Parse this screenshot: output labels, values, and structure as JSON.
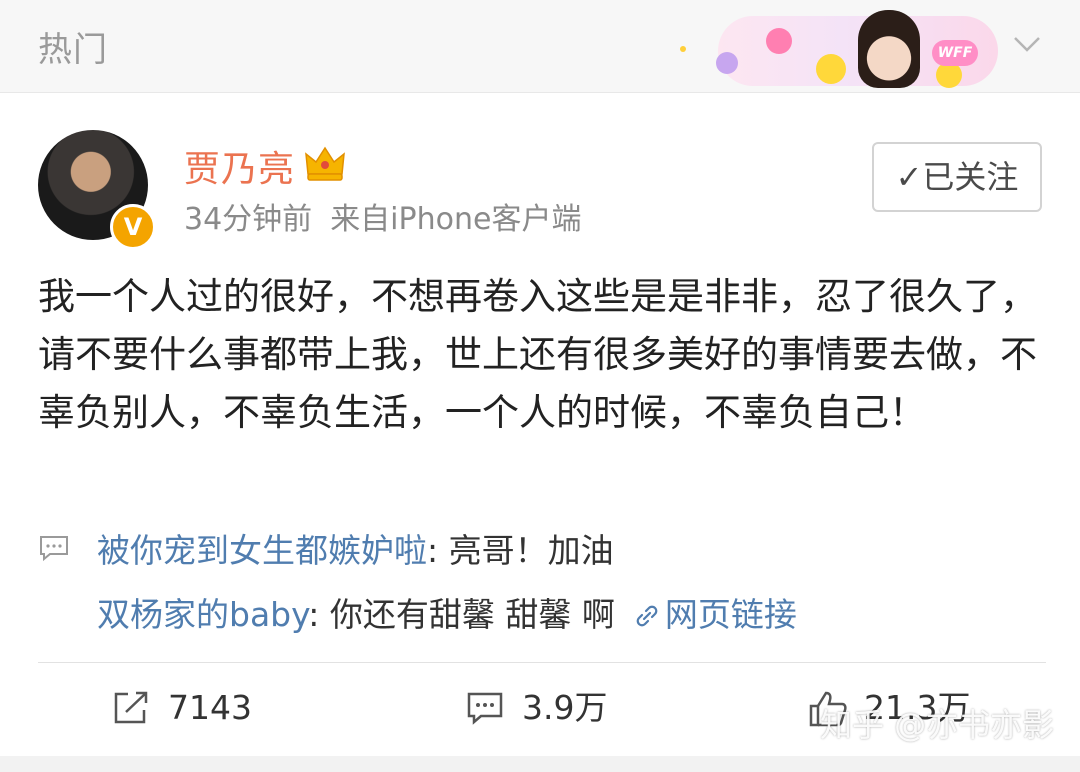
{
  "header": {
    "title": "热门",
    "banner_badge": "WFF",
    "expand_icon": "chevron-down-icon"
  },
  "post": {
    "username": "贾乃亮",
    "verified_icon": "crown-icon",
    "verified_badge": "V",
    "time": "34分钟前",
    "source": "来自iPhone客户端",
    "follow_label": "✓已关注",
    "text": "我一个人过的很好，不想再卷入这些是是非非，忍了很久了，请不要什么事都带上我，世上还有很多美好的事情要去做，不辜负别人，不辜负生活，一个人的时候，不辜负自己！"
  },
  "comments": [
    {
      "nick": "被你宠到女生都嫉妒啦",
      "text": ": 亮哥！加油",
      "link": ""
    },
    {
      "nick": "双杨家的baby",
      "text": ": 你还有甜馨 甜馨 啊",
      "link": "网页链接"
    }
  ],
  "actions": {
    "repost": {
      "icon": "share-icon",
      "count": "7143"
    },
    "comment": {
      "icon": "comment-icon",
      "count": "3.9万"
    },
    "like": {
      "icon": "thumbs-up-icon",
      "count": "21.3万"
    }
  },
  "watermark": "知乎 @亦书亦影",
  "colors": {
    "accent_name": "#eb7350",
    "link_blue": "#507daf",
    "verified_orange": "#f4a400"
  }
}
